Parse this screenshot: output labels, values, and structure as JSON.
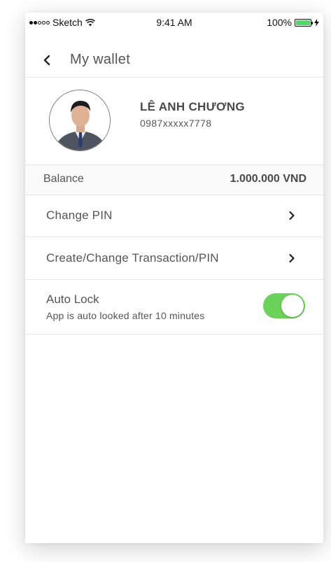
{
  "status_bar": {
    "carrier": "Sketch",
    "time": "9:41 AM",
    "battery": "100%",
    "battery_color": "#4cd964"
  },
  "nav": {
    "back_icon": "chevron-left-icon",
    "title": "My wallet"
  },
  "profile": {
    "name": "LÊ ANH CHƯƠNG",
    "phone": "0987xxxxx7778"
  },
  "balance": {
    "label": "Balance",
    "value": "1.000.000 VND"
  },
  "menu": [
    {
      "label": "Change PIN",
      "icon": "chevron-right-icon"
    },
    {
      "label": "Create/Change Transaction/PIN",
      "icon": "chevron-right-icon"
    }
  ],
  "auto_lock": {
    "title": "Auto Lock",
    "subtitle": "App is auto looked after 10 minutes",
    "enabled": true,
    "toggle_color": "#6cd35a"
  }
}
